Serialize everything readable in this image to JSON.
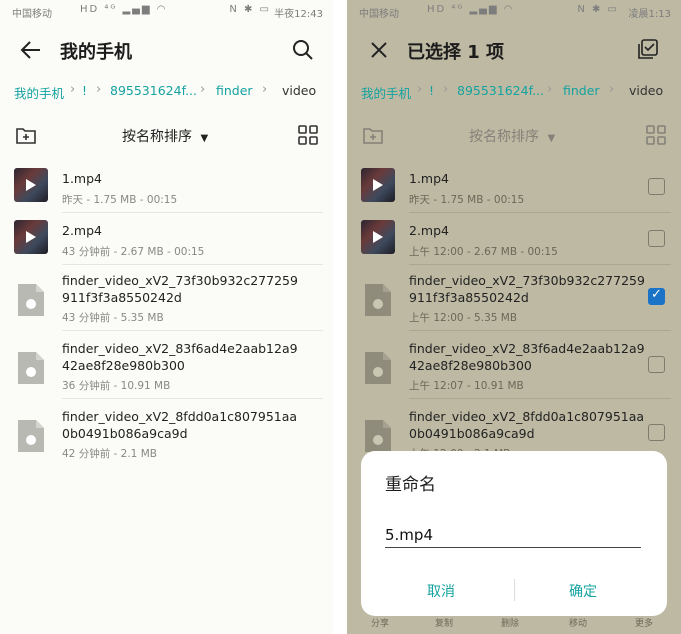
{
  "left": {
    "status": {
      "carrier": "中国移动",
      "time": "半夜12:43"
    },
    "header": {
      "title": "我的手机"
    },
    "breadcrumb": {
      "items": [
        "我的手机",
        "!",
        "895531624f...",
        "finder",
        "video"
      ]
    },
    "toolbar": {
      "sort_label": "按名称排序"
    },
    "files": [
      {
        "name_line1": "1.mp4",
        "name_line2": "",
        "meta": "昨天 - 1.75 MB - 00:15",
        "kind": "video"
      },
      {
        "name_line1": "2.mp4",
        "name_line2": "",
        "meta": "43 分钟前 - 2.67 MB - 00:15",
        "kind": "video"
      },
      {
        "name_line1": "finder_video_xV2_73f30b932c277259",
        "name_line2": "911f3f3a8550242d",
        "meta": "43 分钟前 - 5.35 MB",
        "kind": "file"
      },
      {
        "name_line1": "finder_video_xV2_83f6ad4e2aab12a9",
        "name_line2": "42ae8f28e980b300",
        "meta": "36 分钟前 - 10.91 MB",
        "kind": "file"
      },
      {
        "name_line1": "finder_video_xV2_8fdd0a1c807951aa",
        "name_line2": "0b0491b086a9ca9d",
        "meta": "42 分钟前 - 2.1 MB",
        "kind": "file"
      }
    ]
  },
  "right": {
    "status": {
      "carrier": "中国移动",
      "time": "凌晨1:13"
    },
    "header": {
      "title": "已选择 1 项"
    },
    "breadcrumb": {
      "items": [
        "我的手机",
        "!",
        "895531624f...",
        "finder",
        "video"
      ]
    },
    "toolbar": {
      "sort_label": "按名称排序"
    },
    "files": [
      {
        "name_line1": "1.mp4",
        "name_line2": "",
        "meta": "昨天 - 1.75 MB - 00:15",
        "kind": "video",
        "checked": false
      },
      {
        "name_line1": "2.mp4",
        "name_line2": "",
        "meta": "上午 12:00 - 2.67 MB - 00:15",
        "kind": "video",
        "checked": false
      },
      {
        "name_line1": "finder_video_xV2_73f30b932c277259",
        "name_line2": "911f3f3a8550242d",
        "meta": "上午 12:00 - 5.35 MB",
        "kind": "file",
        "checked": true
      },
      {
        "name_line1": "finder_video_xV2_83f6ad4e2aab12a9",
        "name_line2": "42ae8f28e980b300",
        "meta": "上午 12:07 - 10.91 MB",
        "kind": "file",
        "checked": false
      },
      {
        "name_line1": "finder_video_xV2_8fdd0a1c807951aa",
        "name_line2": "0b0491b086a9ca9d",
        "meta": "上午 12:00 - 2.1 MB",
        "kind": "file",
        "checked": false
      }
    ],
    "dialog": {
      "title": "重命名",
      "input_value": "5.mp4",
      "cancel": "取消",
      "confirm": "确定"
    },
    "bottom_nav": [
      "分享",
      "复制",
      "删除",
      "移动",
      "更多"
    ]
  },
  "colors": {
    "accent": "#14a3a0",
    "checkbox_checked": "#1a73c7",
    "dim_overlay": "#bdb9a3"
  },
  "icons": [
    "back-arrow-icon",
    "search-icon",
    "close-icon",
    "select-all-icon",
    "new-folder-icon",
    "grid-view-icon",
    "sort-caret-icon",
    "play-icon",
    "file-icon",
    "checkbox-icon"
  ]
}
